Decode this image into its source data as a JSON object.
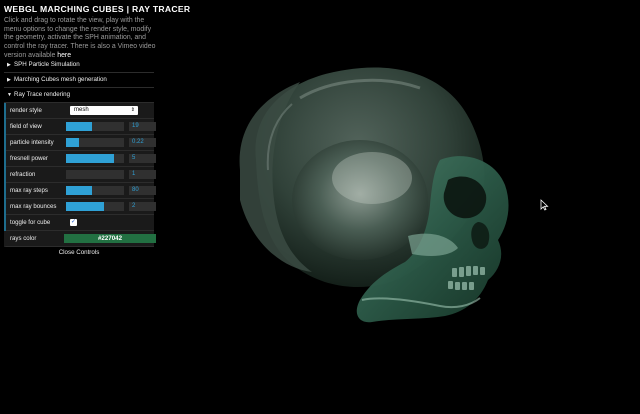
{
  "app": {
    "title": "WEBGL MARCHING CUBES | RAY TRACER",
    "intro": "Click and drag to rotate the view, play with the menu options to change the render style, modify the geometry, activate the SPH animation, and control the ray tracer. There is also a Vimeo video version available",
    "intro_link": "here"
  },
  "gui": {
    "folders": [
      {
        "label": "SPH Particle Simulation",
        "expanded": false
      },
      {
        "label": "Marching Cubes mesh generation",
        "expanded": false
      },
      {
        "label": "Ray Trace rendering",
        "expanded": true
      }
    ],
    "render_style": {
      "label": "render style",
      "value": "mesh"
    },
    "sliders": [
      {
        "label": "field of view",
        "value": "19",
        "fraction": 0.45
      },
      {
        "label": "particle intensity",
        "value": "0.22",
        "fraction": 0.22
      },
      {
        "label": "fresnell power",
        "value": "5",
        "fraction": 0.83
      },
      {
        "label": "refraction",
        "value": "1",
        "fraction": 0.0
      },
      {
        "label": "max ray steps",
        "value": "80",
        "fraction": 0.44
      },
      {
        "label": "max ray bounces",
        "value": "2",
        "fraction": 0.66
      }
    ],
    "toggle_cube": {
      "label": "toggle for cube",
      "checked": true
    },
    "rays_color": {
      "label": "rays color",
      "value": "#227042",
      "color": "#227042"
    },
    "close_label": "Close Controls"
  },
  "colors": {
    "accent": "#2fa1d6",
    "rays": "#227042",
    "background": "#000000"
  }
}
